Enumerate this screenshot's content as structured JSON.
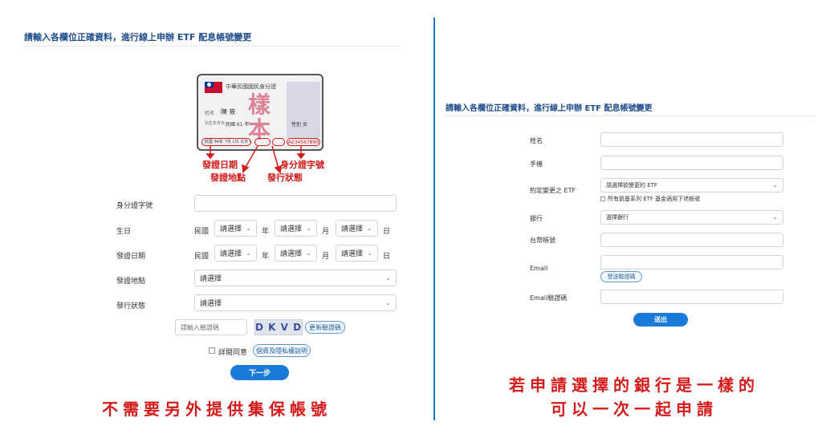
{
  "left": {
    "heading": "請輸入各欄位正確資料，進行線上申辦 ETF 配息帳號變更",
    "id_card": {
      "title": "中華民國國民身分證",
      "name_label": "姓名",
      "name_value": "陳 筱",
      "birth_label": "出生年月日",
      "birth_value": "民國 61 年",
      "gender_label": "性別",
      "gender_value": "女",
      "issue_line": "民國 94年 7月 1日 北市 補發",
      "id_number": "A234567890",
      "stamp": "樣本"
    },
    "annotations": {
      "issue_date": "發證日期",
      "issue_place": "發證地點",
      "id_number": "身分證字號",
      "issue_status": "發行狀態"
    },
    "form": {
      "id_label": "身分證字號",
      "birth_label": "生日",
      "issue_date_label": "發證日期",
      "issue_place_label": "發證地點",
      "issue_status_label": "發行狀態",
      "era": "民國",
      "select_placeholder": "請選擇",
      "year_unit": "年",
      "month_unit": "月",
      "day_unit": "日",
      "place_select": "請選擇",
      "status_select": "請選擇",
      "captcha_placeholder": "請輸入驗證碼",
      "captcha_text": "D K V D",
      "refresh_captcha": "更新驗證碼",
      "agree_text": "詳閱同意",
      "privacy_button": "個資及隱私權說明",
      "next_button": "下一步"
    },
    "caption": "不需要另外提供集保帳號"
  },
  "right": {
    "heading": "請輸入各欄位正確資料，進行線上申辦 ETF 配息帳號變更",
    "form": {
      "name_label": "姓名",
      "phone_label": "手機",
      "etf_label": "約定變更之 ETF",
      "etf_select": "請選擇欲變更的 ETF",
      "all_etf_checkbox": "所有凱基系列 ETF 基金適用下述帳號",
      "bank_label": "銀行",
      "bank_select": "選擇銀行",
      "account_label": "台幣帳號",
      "email_label": "Email",
      "send_code_button": "發送驗證碼",
      "email_code_label": "Email驗證碼",
      "submit_button": "送出"
    },
    "caption_line1": "若申請選擇的銀行是一樣的",
    "caption_line2": "可以一次一起申請"
  },
  "colors": {
    "heading": "#1f4e8c",
    "accent_blue": "#1a7ad9",
    "divider": "#1a73c9",
    "annotation_red": "#d41a1a"
  }
}
